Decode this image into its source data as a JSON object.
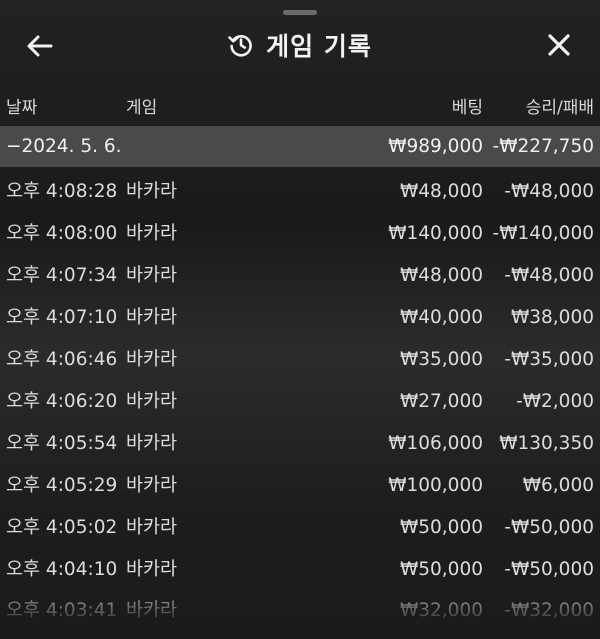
{
  "header": {
    "title": "게임 기록",
    "back_icon": "arrow-left-icon",
    "history_icon": "history-icon",
    "close_icon": "close-icon"
  },
  "columns": {
    "date": "날짜",
    "game": "게임",
    "bet": "베팅",
    "result": "승리/패배"
  },
  "summary": {
    "date": "−2024. 5. 6.",
    "bet": "₩989,000",
    "result": "-₩227,750"
  },
  "rows": [
    {
      "time": "오후 4:08:28",
      "game": "바카라",
      "bet": "₩48,000",
      "result": "-₩48,000"
    },
    {
      "time": "오후 4:08:00",
      "game": "바카라",
      "bet": "₩140,000",
      "result": "-₩140,000"
    },
    {
      "time": "오후 4:07:34",
      "game": "바카라",
      "bet": "₩48,000",
      "result": "-₩48,000"
    },
    {
      "time": "오후 4:07:10",
      "game": "바카라",
      "bet": "₩40,000",
      "result": "₩38,000"
    },
    {
      "time": "오후 4:06:46",
      "game": "바카라",
      "bet": "₩35,000",
      "result": "-₩35,000"
    },
    {
      "time": "오후 4:06:20",
      "game": "바카라",
      "bet": "₩27,000",
      "result": "-₩2,000"
    },
    {
      "time": "오후 4:05:54",
      "game": "바카라",
      "bet": "₩106,000",
      "result": "₩130,350"
    },
    {
      "time": "오후 4:05:29",
      "game": "바카라",
      "bet": "₩100,000",
      "result": "₩6,000"
    },
    {
      "time": "오후 4:05:02",
      "game": "바카라",
      "bet": "₩50,000",
      "result": "-₩50,000"
    },
    {
      "time": "오후 4:04:10",
      "game": "바카라",
      "bet": "₩50,000",
      "result": "-₩50,000"
    },
    {
      "time": "오후 4:03:41",
      "game": "바카라",
      "bet": "₩32,000",
      "result": "-₩32,000"
    }
  ]
}
